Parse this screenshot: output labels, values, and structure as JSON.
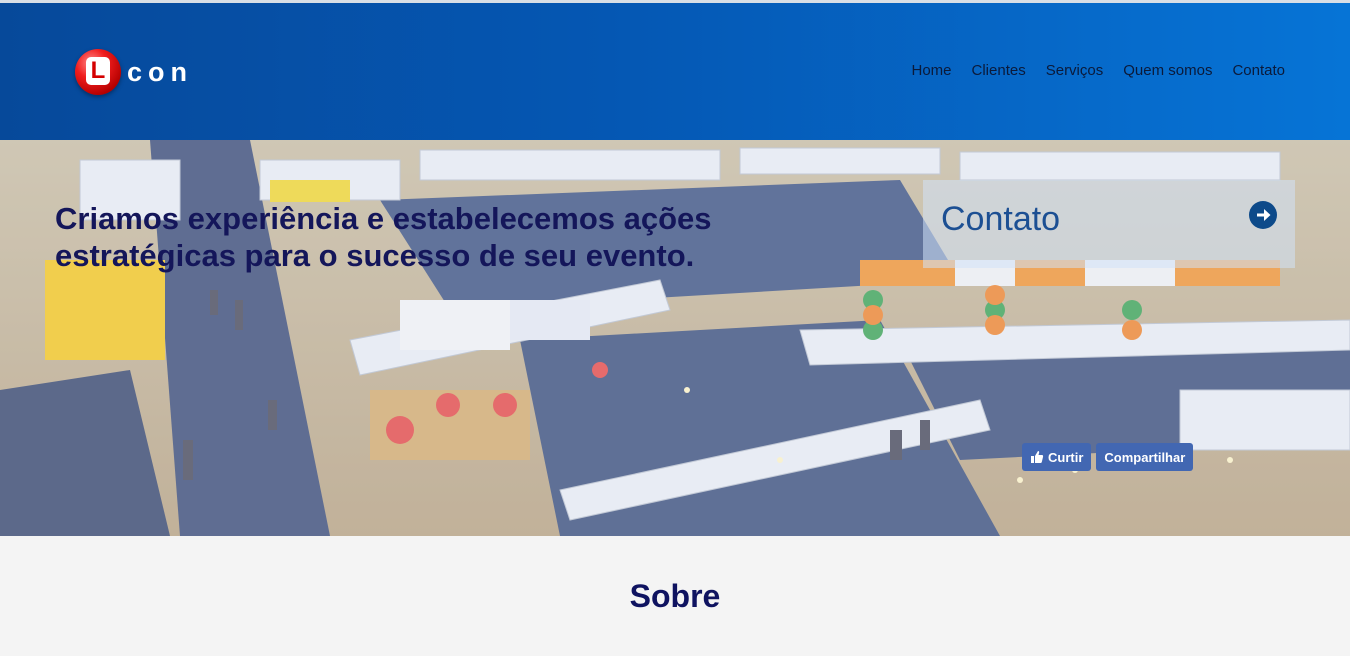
{
  "header": {
    "logo_letter": "L",
    "logo_text": "con",
    "nav": [
      "Home",
      "Clientes",
      "Serviços",
      "Quem somos",
      "Contato"
    ]
  },
  "hero": {
    "headline": "Criamos experiência e estabelecemos ações estratégicas para o sucesso de seu evento.",
    "contact_label": "Contato",
    "arrow_icon": "circle-arrow-right-icon",
    "facebook": {
      "like_label": "Curtir",
      "share_label": "Compartilhar",
      "like_icon": "thumbs-up-icon"
    }
  },
  "section": {
    "title": "Sobre"
  },
  "colors": {
    "header_start": "#06499a",
    "header_end": "#0674d6",
    "headline": "#14165a",
    "facebook_blue": "#4267b2",
    "section_bg": "#f4f4f4"
  }
}
